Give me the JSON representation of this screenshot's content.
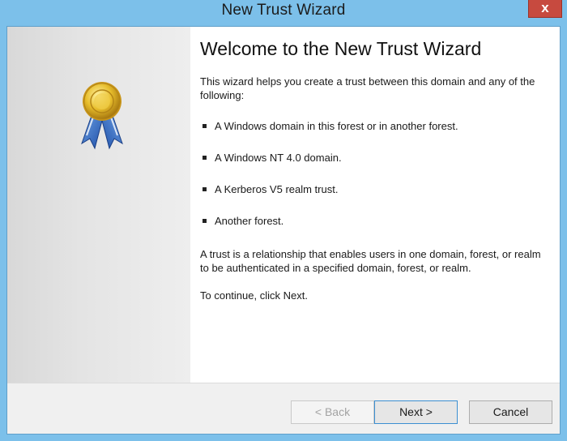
{
  "window": {
    "title": "New Trust Wizard",
    "close_glyph": "x"
  },
  "side_panel": {
    "icon": "award-medal-icon"
  },
  "content": {
    "heading": "Welcome to the New Trust Wizard",
    "intro": "This wizard helps you create a trust between this domain and any of the following:",
    "bullets": [
      "A Windows domain in this forest or in another forest.",
      "A Windows NT 4.0 domain.",
      "A Kerberos V5 realm trust.",
      "Another forest."
    ],
    "relationship": "A trust is a relationship that enables users in one domain, forest, or realm to be authenticated in a specified domain, forest, or realm.",
    "continue_text": "To continue, click Next."
  },
  "buttons": {
    "back": "< Back",
    "next": "Next >",
    "cancel": "Cancel"
  },
  "colors": {
    "title_bar": "#7cc0ea",
    "close_button": "#c74a3f",
    "focus_border": "#3c8fd2"
  }
}
